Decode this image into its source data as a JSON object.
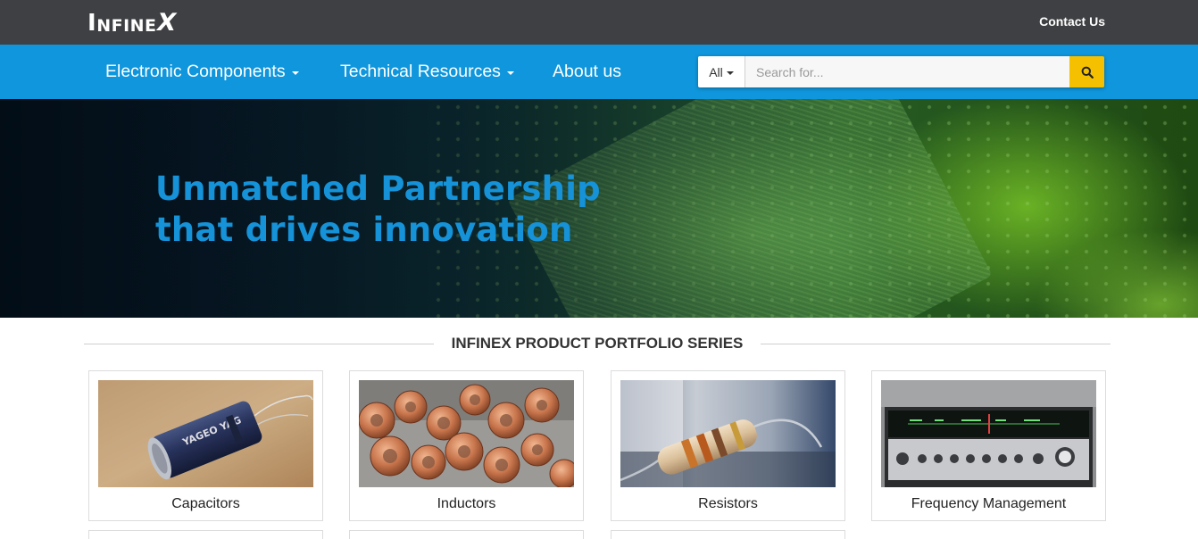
{
  "header": {
    "logo_text": "INFINEX",
    "contact_label": "Contact Us"
  },
  "nav": {
    "items": [
      {
        "label": "Electronic Components",
        "dropdown": true
      },
      {
        "label": "Technical Resources",
        "dropdown": true
      },
      {
        "label": "About us",
        "dropdown": false
      }
    ]
  },
  "search": {
    "scope_label": "All",
    "placeholder": "Search for...",
    "value": "",
    "button_icon": "search-icon"
  },
  "hero": {
    "line1": "Unmatched Partnership",
    "line2": "that drives innovation"
  },
  "portfolio": {
    "title": "INFINEX PRODUCT PORTFOLIO SERIES",
    "cards": [
      {
        "label": "Capacitors",
        "image": "capacitor-photo"
      },
      {
        "label": "Inductors",
        "image": "inductors-photo"
      },
      {
        "label": "Resistors",
        "image": "resistor-photo"
      },
      {
        "label": "Frequency Management",
        "image": "radio-receiver-photo"
      }
    ]
  },
  "colors": {
    "topbar": "#3f4043",
    "navbar": "#0f96dc",
    "search_button": "#f5c000",
    "hero_text": "#1592d8"
  }
}
